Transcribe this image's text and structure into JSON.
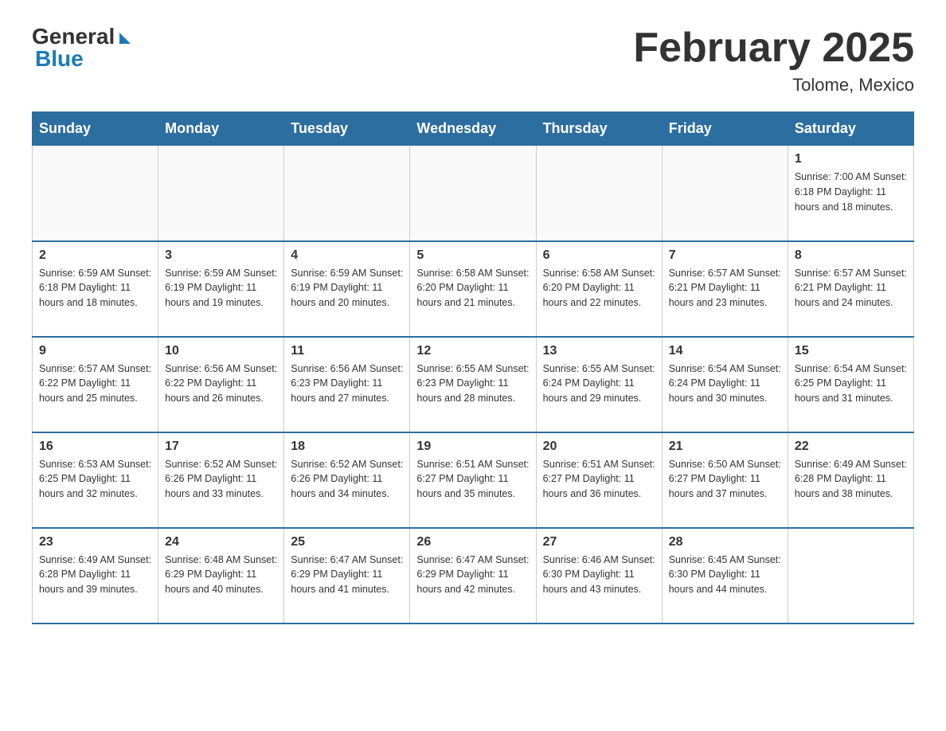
{
  "header": {
    "logo_general": "General",
    "logo_blue": "Blue",
    "month_title": "February 2025",
    "location": "Tolome, Mexico"
  },
  "weekdays": [
    "Sunday",
    "Monday",
    "Tuesday",
    "Wednesday",
    "Thursday",
    "Friday",
    "Saturday"
  ],
  "weeks": [
    [
      {
        "day": "",
        "info": ""
      },
      {
        "day": "",
        "info": ""
      },
      {
        "day": "",
        "info": ""
      },
      {
        "day": "",
        "info": ""
      },
      {
        "day": "",
        "info": ""
      },
      {
        "day": "",
        "info": ""
      },
      {
        "day": "1",
        "info": "Sunrise: 7:00 AM\nSunset: 6:18 PM\nDaylight: 11 hours and 18 minutes."
      }
    ],
    [
      {
        "day": "2",
        "info": "Sunrise: 6:59 AM\nSunset: 6:18 PM\nDaylight: 11 hours and 18 minutes."
      },
      {
        "day": "3",
        "info": "Sunrise: 6:59 AM\nSunset: 6:19 PM\nDaylight: 11 hours and 19 minutes."
      },
      {
        "day": "4",
        "info": "Sunrise: 6:59 AM\nSunset: 6:19 PM\nDaylight: 11 hours and 20 minutes."
      },
      {
        "day": "5",
        "info": "Sunrise: 6:58 AM\nSunset: 6:20 PM\nDaylight: 11 hours and 21 minutes."
      },
      {
        "day": "6",
        "info": "Sunrise: 6:58 AM\nSunset: 6:20 PM\nDaylight: 11 hours and 22 minutes."
      },
      {
        "day": "7",
        "info": "Sunrise: 6:57 AM\nSunset: 6:21 PM\nDaylight: 11 hours and 23 minutes."
      },
      {
        "day": "8",
        "info": "Sunrise: 6:57 AM\nSunset: 6:21 PM\nDaylight: 11 hours and 24 minutes."
      }
    ],
    [
      {
        "day": "9",
        "info": "Sunrise: 6:57 AM\nSunset: 6:22 PM\nDaylight: 11 hours and 25 minutes."
      },
      {
        "day": "10",
        "info": "Sunrise: 6:56 AM\nSunset: 6:22 PM\nDaylight: 11 hours and 26 minutes."
      },
      {
        "day": "11",
        "info": "Sunrise: 6:56 AM\nSunset: 6:23 PM\nDaylight: 11 hours and 27 minutes."
      },
      {
        "day": "12",
        "info": "Sunrise: 6:55 AM\nSunset: 6:23 PM\nDaylight: 11 hours and 28 minutes."
      },
      {
        "day": "13",
        "info": "Sunrise: 6:55 AM\nSunset: 6:24 PM\nDaylight: 11 hours and 29 minutes."
      },
      {
        "day": "14",
        "info": "Sunrise: 6:54 AM\nSunset: 6:24 PM\nDaylight: 11 hours and 30 minutes."
      },
      {
        "day": "15",
        "info": "Sunrise: 6:54 AM\nSunset: 6:25 PM\nDaylight: 11 hours and 31 minutes."
      }
    ],
    [
      {
        "day": "16",
        "info": "Sunrise: 6:53 AM\nSunset: 6:25 PM\nDaylight: 11 hours and 32 minutes."
      },
      {
        "day": "17",
        "info": "Sunrise: 6:52 AM\nSunset: 6:26 PM\nDaylight: 11 hours and 33 minutes."
      },
      {
        "day": "18",
        "info": "Sunrise: 6:52 AM\nSunset: 6:26 PM\nDaylight: 11 hours and 34 minutes."
      },
      {
        "day": "19",
        "info": "Sunrise: 6:51 AM\nSunset: 6:27 PM\nDaylight: 11 hours and 35 minutes."
      },
      {
        "day": "20",
        "info": "Sunrise: 6:51 AM\nSunset: 6:27 PM\nDaylight: 11 hours and 36 minutes."
      },
      {
        "day": "21",
        "info": "Sunrise: 6:50 AM\nSunset: 6:27 PM\nDaylight: 11 hours and 37 minutes."
      },
      {
        "day": "22",
        "info": "Sunrise: 6:49 AM\nSunset: 6:28 PM\nDaylight: 11 hours and 38 minutes."
      }
    ],
    [
      {
        "day": "23",
        "info": "Sunrise: 6:49 AM\nSunset: 6:28 PM\nDaylight: 11 hours and 39 minutes."
      },
      {
        "day": "24",
        "info": "Sunrise: 6:48 AM\nSunset: 6:29 PM\nDaylight: 11 hours and 40 minutes."
      },
      {
        "day": "25",
        "info": "Sunrise: 6:47 AM\nSunset: 6:29 PM\nDaylight: 11 hours and 41 minutes."
      },
      {
        "day": "26",
        "info": "Sunrise: 6:47 AM\nSunset: 6:29 PM\nDaylight: 11 hours and 42 minutes."
      },
      {
        "day": "27",
        "info": "Sunrise: 6:46 AM\nSunset: 6:30 PM\nDaylight: 11 hours and 43 minutes."
      },
      {
        "day": "28",
        "info": "Sunrise: 6:45 AM\nSunset: 6:30 PM\nDaylight: 11 hours and 44 minutes."
      },
      {
        "day": "",
        "info": ""
      }
    ]
  ]
}
